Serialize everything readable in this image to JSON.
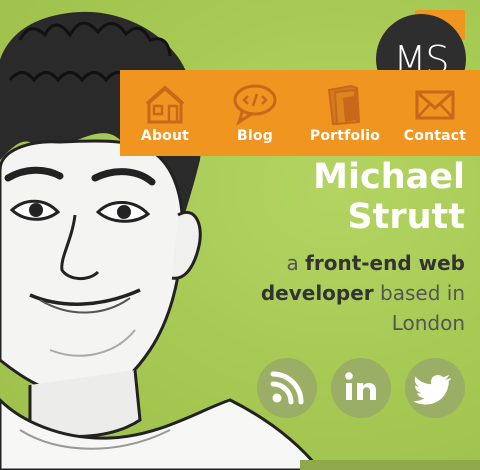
{
  "logo": {
    "initials": "MS"
  },
  "nav": {
    "items": [
      {
        "label": "About",
        "icon": "house-icon"
      },
      {
        "label": "Blog",
        "icon": "speech-bubble-code-icon"
      },
      {
        "label": "Portfolio",
        "icon": "folder-icon"
      },
      {
        "label": "Contact",
        "icon": "envelope-icon"
      }
    ]
  },
  "hero": {
    "name_line1": "Michael",
    "name_line2": "Strutt",
    "tagline_prefix": "a ",
    "tagline_bold": "front-end web developer",
    "tagline_suffix": " based in London"
  },
  "social": [
    {
      "icon": "rss-icon"
    },
    {
      "icon": "linkedin-icon"
    },
    {
      "icon": "twitter-icon"
    }
  ],
  "colors": {
    "accent": "#f0951f",
    "background": "#a8cc55",
    "social": "#9aae66",
    "dark": "#2e2e2e"
  }
}
